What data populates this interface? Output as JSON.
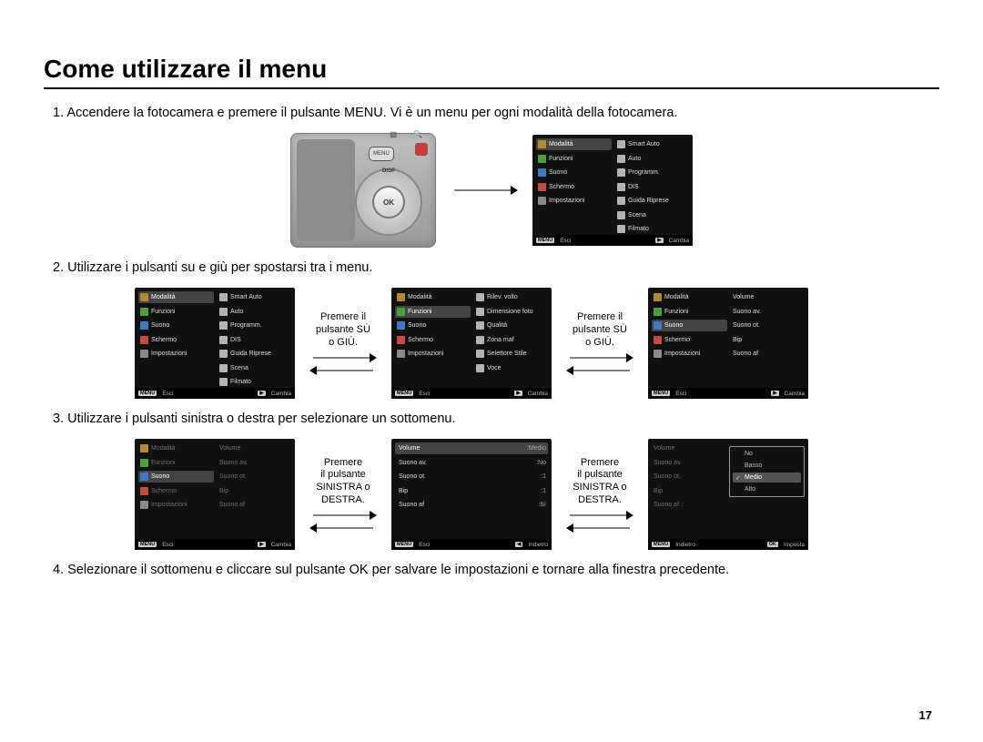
{
  "title": "Come utilizzare il menu",
  "step1": "1. Accendere la fotocamera e premere il pulsante MENU. Vi è un menu per ogni modalità della fotocamera.",
  "step2": "2. Utilizzare i pulsanti su e giù per spostarsi tra i menu.",
  "step3": "3. Utilizzare i pulsanti sinistra o destra per selezionare un sottomenu.",
  "step4": "4. Selezionare il sottomenu e cliccare sul pulsante OK per salvare le impostazioni e tornare alla finestra precedente.",
  "device": {
    "menu": "MENU",
    "ok": "OK",
    "disp": "DISP",
    "topIcons": [
      "▧",
      "🔍"
    ]
  },
  "labels": {
    "pressUpDown": "Premere il\npulsante SÙ\no GIÙ.",
    "pressLR": "Premere\nil pulsante\nSINISTRA o\nDESTRA."
  },
  "footer": {
    "esci": "Esci",
    "cambia": "Cambia",
    "indietro": "Indietro",
    "imposta": "Imposta",
    "menuTag": "MENU",
    "playTag": "▶",
    "backTag": "◀",
    "okTag": "OK"
  },
  "menuLeft": [
    "Modalità",
    "Funzioni",
    "Suono",
    "Schermo",
    "Impostazioni"
  ],
  "modeRight": [
    "Smart Auto",
    "Auto",
    "Programm.",
    "DIS",
    "Guida Riprese",
    "Scena",
    "Filmato"
  ],
  "funzRight": [
    "Rilev. volto",
    "Dimensione foto",
    "Qualità",
    "Zona maf",
    "Selettore Stile",
    "Voce"
  ],
  "soundRight": [
    "Volume",
    "Suono av.",
    "Suono ot.",
    "Bip",
    "Suono af"
  ],
  "soundValsRight": [
    "Volume",
    "Suono av.",
    "Suono ot.",
    "Bip",
    "Suono af"
  ],
  "soundVals": {
    "Volume": "Medio",
    "Suono av.": "No",
    "Suono ot.": "1",
    "Bip": "1",
    "Suono af": "Sì"
  },
  "volumeOptions": [
    "No",
    "Basso",
    "Medio",
    "Alto"
  ],
  "pageNo": "17"
}
